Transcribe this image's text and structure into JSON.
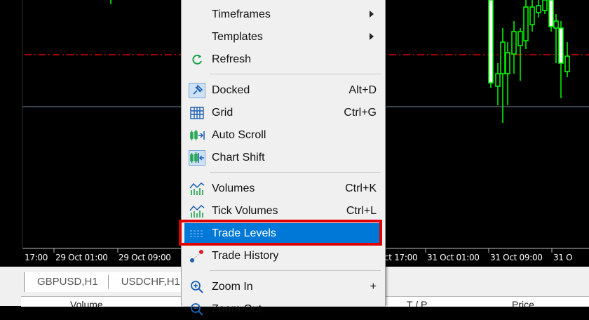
{
  "chart": {
    "time_labels": [
      "17:00",
      "29 Oct 01:00",
      "29 Oct 09:00",
      "ct 17:00",
      "31 Oct 01:00",
      "31 Oct 09:00",
      "31 O"
    ],
    "colors": {
      "background": "#000000",
      "candles": "#00ff00",
      "trade_level": "#d00000",
      "price_line": "#778899"
    }
  },
  "tabs": [
    "GBPUSD,H1",
    "USDCHF,H1"
  ],
  "columns": [
    "Volume",
    "T / P",
    "Price"
  ],
  "menu": {
    "items": [
      {
        "label": "Timeframes",
        "submenu": true,
        "icon": ""
      },
      {
        "label": "Templates",
        "submenu": true,
        "icon": ""
      },
      {
        "label": "Refresh",
        "icon": "refresh-icon"
      },
      {
        "label": "Docked",
        "shortcut": "Alt+D",
        "icon": "pin-icon"
      },
      {
        "label": "Grid",
        "shortcut": "Ctrl+G",
        "icon": "grid-icon"
      },
      {
        "label": "Auto Scroll",
        "icon": "auto-scroll-icon"
      },
      {
        "label": "Chart Shift",
        "icon": "chart-shift-icon"
      },
      {
        "label": "Volumes",
        "shortcut": "Ctrl+K",
        "icon": "volumes-icon"
      },
      {
        "label": "Tick Volumes",
        "shortcut": "Ctrl+L",
        "icon": "tick-volumes-icon"
      },
      {
        "label": "Trade Levels",
        "icon": "trade-levels-icon",
        "selected": true
      },
      {
        "label": "Trade History",
        "icon": "trade-history-icon"
      },
      {
        "label": "Zoom In",
        "shortcut": "+",
        "icon": "zoom-in-icon"
      },
      {
        "label": "Zoom Out",
        "icon": "zoom-out-icon"
      }
    ],
    "selected_color": "#0078d7",
    "highlight_border_color": "#e00000"
  }
}
